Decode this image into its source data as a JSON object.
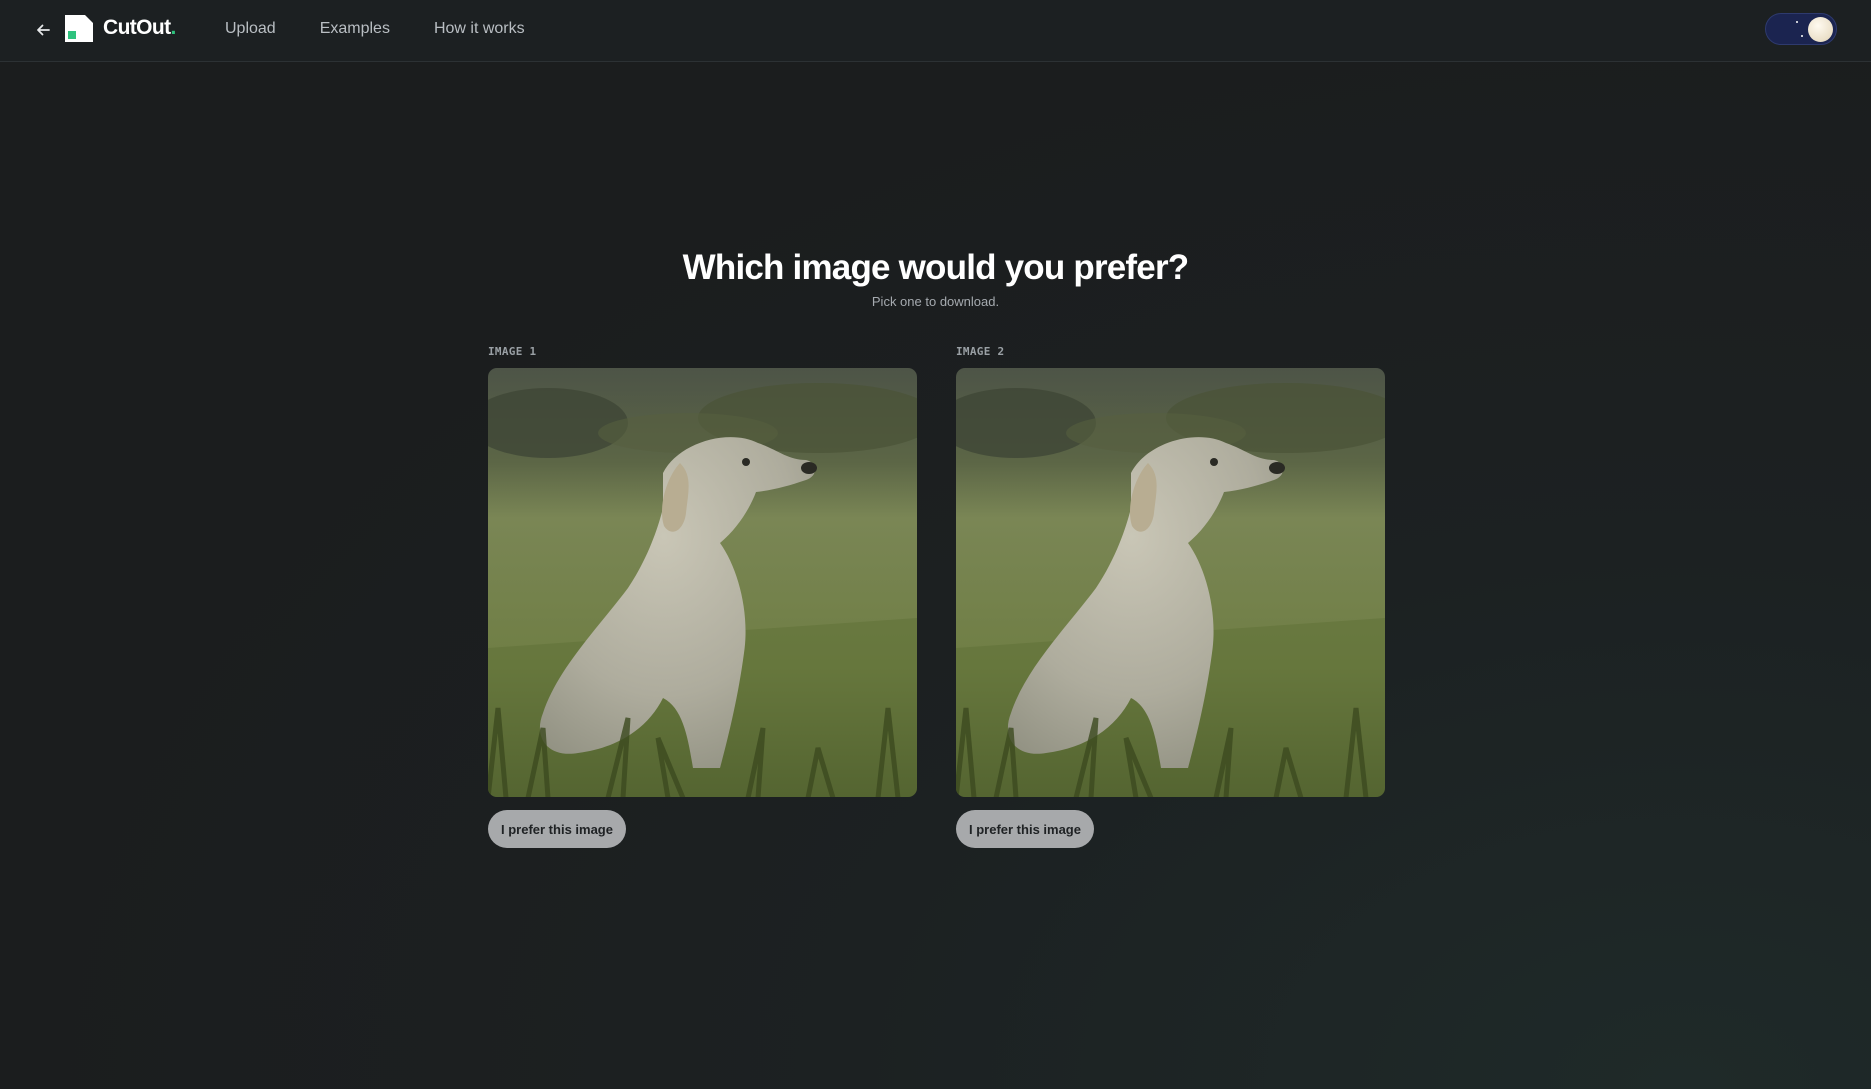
{
  "header": {
    "back_icon": "arrow-left-icon",
    "brand_name": "CutOut",
    "brand_dot": ".",
    "nav": [
      "Upload",
      "Examples",
      "How it works"
    ],
    "theme_toggle": {
      "mode": "dark",
      "icon": "moon-sun-toggle"
    }
  },
  "main": {
    "title": "Which image would you prefer?",
    "subtitle": "Pick one to download.",
    "options": [
      {
        "label": "IMAGE 1",
        "button": "I prefer this image"
      },
      {
        "label": "IMAGE 2",
        "button": "I prefer this image"
      }
    ]
  },
  "colors": {
    "background": "#1c1e1f",
    "topbar": "#1c2022",
    "accent": "#2ec27e",
    "button": "#a7a9ab",
    "toggle": "#1b2450"
  }
}
